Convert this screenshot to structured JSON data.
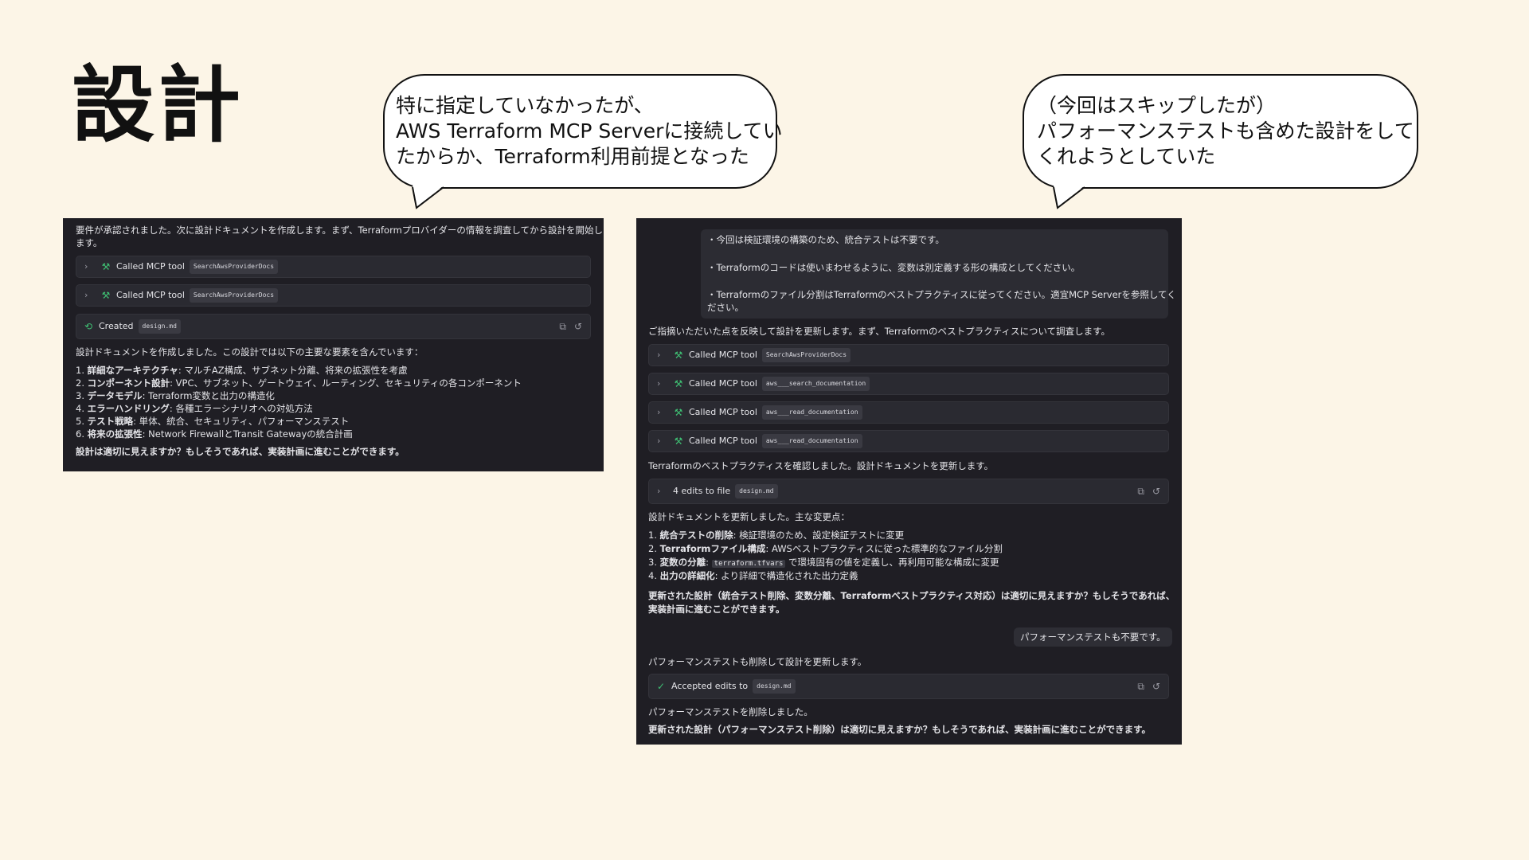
{
  "slide": {
    "title": "設計"
  },
  "bubbles": {
    "left": [
      "特に指定していなかったが、",
      "AWS Terraform MCP Serverに接続してい",
      "たからか、Terraform利用前提となった"
    ],
    "right": [
      "（今回はスキップしたが）",
      "パフォーマンステストも含めた設計をして",
      "くれようとしていた"
    ]
  },
  "left_shot": {
    "intro": [
      "要件が承認されました。次に設計ドキュメントを作成します。まず、Terraformプロバイダーの情報を調査してから設計を開始し",
      "ます。"
    ],
    "tool_rows": [
      {
        "label": "Called MCP tool",
        "chip": "SearchAwsProviderDocs"
      },
      {
        "label": "Called MCP tool",
        "chip": "SearchAwsProviderDocs"
      }
    ],
    "created_row": {
      "label": "Created",
      "chip": "design.md"
    },
    "summary": "設計ドキュメントを作成しました。この設計では以下の主要な要素を含んでいます：",
    "list": [
      {
        "num": "1.",
        "bold": "詳細なアーキテクチャ",
        "rest": ": マルチAZ構成、サブネット分離、将来の拡張性を考慮"
      },
      {
        "num": "2.",
        "bold": "コンポーネント設計",
        "rest": ": VPC、サブネット、ゲートウェイ、ルーティング、セキュリティの各コンポーネント"
      },
      {
        "num": "3.",
        "bold": "データモデル",
        "rest": ": Terraform変数と出力の構造化"
      },
      {
        "num": "4.",
        "bold": "エラーハンドリング",
        "rest": ": 各種エラーシナリオへの対処方法"
      },
      {
        "num": "5.",
        "bold": "テスト戦略",
        "rest": ": 単体、統合、セキュリティ、パフォーマンステスト"
      },
      {
        "num": "6.",
        "bold": "将来の拡張性",
        "rest": ": Network FirewallとTransit Gatewayの統合計画"
      }
    ],
    "question": "設計は適切に見えますか？もしそうであれば、実装計画に進むことができます。"
  },
  "right_shot": {
    "quote": [
      "・今回は検証環境の構築のため、統合テストは不要です。",
      "・Terraformのコードは使いまわせるように、変数は別定義する形の構成としてください。",
      "・Terraformのファイル分割はTerraformのベストプラクティスに従ってください。適宜MCP Serverを参照してく",
      "ださい。"
    ],
    "reflect": "ご指摘いただいた点を反映して設計を更新します。まず、Terraformのベストプラクティスについて調査します。",
    "tool_rows": [
      {
        "label": "Called MCP tool",
        "chip": "SearchAwsProviderDocs"
      },
      {
        "label": "Called MCP tool",
        "chip": "aws___search_documentation"
      },
      {
        "label": "Called MCP tool",
        "chip": "aws___read_documentation"
      },
      {
        "label": "Called MCP tool",
        "chip": "aws___read_documentation"
      }
    ],
    "confirmed": "Terraformのベストプラクティスを確認しました。設計ドキュメントを更新します。",
    "edits_row": {
      "label": "4 edits to file",
      "chip": "design.md"
    },
    "updated": "設計ドキュメントを更新しました。主な変更点：",
    "list": [
      {
        "num": "1.",
        "bold": "統合テストの削除",
        "rest": ": 検証環境のため、設定検証テストに変更"
      },
      {
        "num": "2.",
        "bold": "Terraformファイル構成",
        "rest": ": AWSベストプラクティスに従った標準的なファイル分割"
      },
      {
        "num": "3.",
        "bold": "変数の分離",
        "code": "terraform.tfvars",
        "rest": " で環境固有の値を定義し、再利用可能な構成に変更"
      },
      {
        "num": "4.",
        "bold": "出力の詳細化",
        "rest": ": より詳細で構造化された出力定義"
      }
    ],
    "question1": [
      "更新された設計（統合テスト削除、変数分離、Terraformベストプラクティス対応）は適切に見えますか？もしそうであれば、",
      "実装計画に進むことができます。"
    ],
    "user_msg": "パフォーマンステストも不要です。",
    "perf_update": "パフォーマンステストも削除して設計を更新します。",
    "accepted_row": {
      "label": "Accepted edits to",
      "chip": "design.md"
    },
    "perf_removed": "パフォーマンステストを削除しました。",
    "question2": "更新された設計（パフォーマンステスト削除）は適切に見えますか？もしそうであれば、実装計画に進むことができます。"
  },
  "colors": {
    "background": "#fcf5e7",
    "panel": "#1f1e24",
    "accent_green": "#3fbf73"
  },
  "icons": [
    "chevron-right-icon",
    "wrench-icon",
    "created-icon",
    "check-circle-icon",
    "compare-icon",
    "undo-icon"
  ]
}
